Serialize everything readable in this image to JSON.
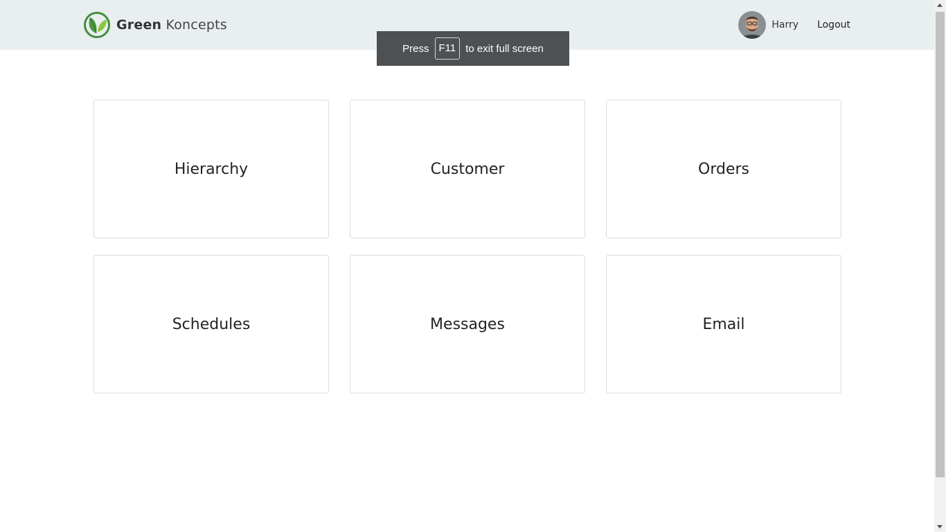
{
  "header": {
    "brand_bold": "Green",
    "brand_light": "Koncepts",
    "user_name": "Harry",
    "logout_label": "Logout"
  },
  "fullscreen_notice": {
    "prefix": "Press",
    "key": "F11",
    "suffix": "to exit full screen"
  },
  "tiles": [
    {
      "label": "Hierarchy"
    },
    {
      "label": "Customer"
    },
    {
      "label": "Orders"
    },
    {
      "label": "Schedules"
    },
    {
      "label": "Messages"
    },
    {
      "label": "Email"
    }
  ],
  "icons": {
    "brand": "leaf-logo-icon",
    "avatar": "user-avatar"
  },
  "colors": {
    "header_bg": "#e9eef1",
    "logo_green": "#4a9a3b",
    "notice_bg": "#4d5154"
  }
}
